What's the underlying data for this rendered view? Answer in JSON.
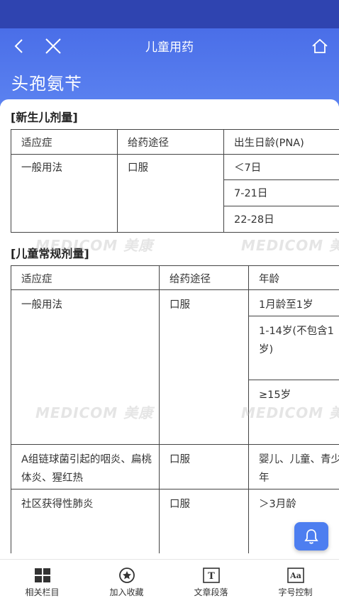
{
  "header": {
    "nav_title": "儿童用药",
    "drug_name": "头孢氨苄"
  },
  "watermark_text": "MEDICOM 美康",
  "neonatal": {
    "section_title": "[新生儿剂量]",
    "headers": [
      "适应症",
      "给药途径",
      "出生日龄(PNA)"
    ],
    "indication": "一般用法",
    "route": "口服",
    "ages": [
      "＜7日",
      "7-21日",
      "22-28日"
    ]
  },
  "pediatric": {
    "section_title": "[儿童常规剂量]",
    "headers": [
      "适应症",
      "给药途径",
      "年龄"
    ],
    "rows": [
      {
        "indication": "一般用法",
        "route": "口服",
        "ages": [
          "1月龄至1岁",
          "1-14岁(不包含1岁)",
          "≥15岁"
        ]
      },
      {
        "indication": "A组链球菌引起的咽炎、扁桃体炎、猩红热",
        "route": "口服",
        "ages": [
          "婴儿、儿童、青少年"
        ]
      },
      {
        "indication": "社区获得性肺炎",
        "route": "口服",
        "ages": [
          "＞3月龄"
        ]
      }
    ]
  },
  "tabbar": {
    "items": [
      {
        "label": "相关栏目",
        "icon": "grid-icon"
      },
      {
        "label": "加入收藏",
        "icon": "star-icon"
      },
      {
        "label": "文章段落",
        "icon": "text-t-icon"
      },
      {
        "label": "字号控制",
        "icon": "font-aa-icon"
      }
    ]
  },
  "colors": {
    "header": "#4a6ee8",
    "status_bar": "#2f44b0",
    "fab": "#4d7ef0"
  }
}
